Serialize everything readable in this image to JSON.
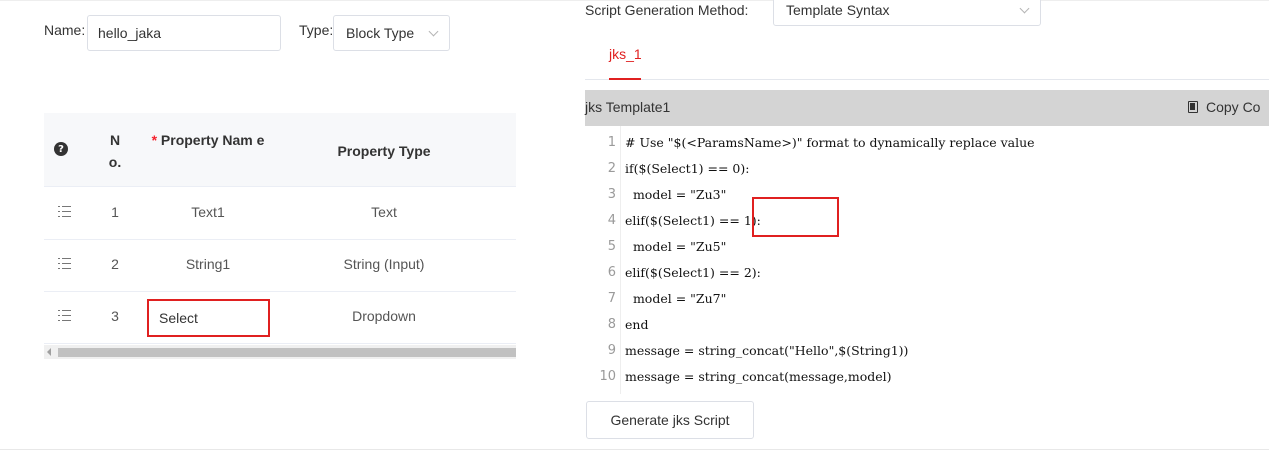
{
  "form": {
    "name_label": "Name:",
    "name_value": "hello_jaka",
    "type_label": "Type:",
    "type_value": "Block Type"
  },
  "table": {
    "headers": {
      "no": "N o.",
      "required_mark": "*",
      "property_name": "Property Nam e",
      "property_type": "Property Type"
    },
    "rows": [
      {
        "no": "1",
        "name": "Text1",
        "type": "Text"
      },
      {
        "no": "2",
        "name": "String1",
        "type": "String (Input)"
      },
      {
        "no": "3",
        "name": "Select",
        "type": "Dropdown"
      }
    ]
  },
  "script": {
    "method_label": "Script Generation Method:",
    "method_value": "Template Syntax",
    "tab_label": "jks_1",
    "editor_title": "jks Template1",
    "copy_label": "Copy Co",
    "lines": [
      {
        "n": "1",
        "text": "# Use \"$(<ParamsName>)\" format to dynamically replace value"
      },
      {
        "n": "2",
        "text": "if($(Select1) == 0):"
      },
      {
        "n": "3",
        "text": "  model = \"Zu3\""
      },
      {
        "n": "4",
        "text": "elif($(Select1) == 1):"
      },
      {
        "n": "5",
        "text": "  model = \"Zu5\""
      },
      {
        "n": "6",
        "text": "elif($(Select1) == 2):"
      },
      {
        "n": "7",
        "text": "  model = \"Zu7\""
      },
      {
        "n": "8",
        "text": "end"
      },
      {
        "n": "9",
        "text": "message = string_concat(\"Hello\",$(String1))"
      },
      {
        "n": "10",
        "text": "message = string_concat(message,model)"
      }
    ],
    "generate_label": "Generate jks Script"
  },
  "colors": {
    "accent": "#e02020",
    "header_bg": "#d4d4d4",
    "table_header_bg": "#f7f8fa"
  },
  "icons": {
    "help": "question-circle-icon",
    "drag": "drag-handle-icon",
    "copy": "copy-icon",
    "dropdown": "chevron-down-icon"
  }
}
